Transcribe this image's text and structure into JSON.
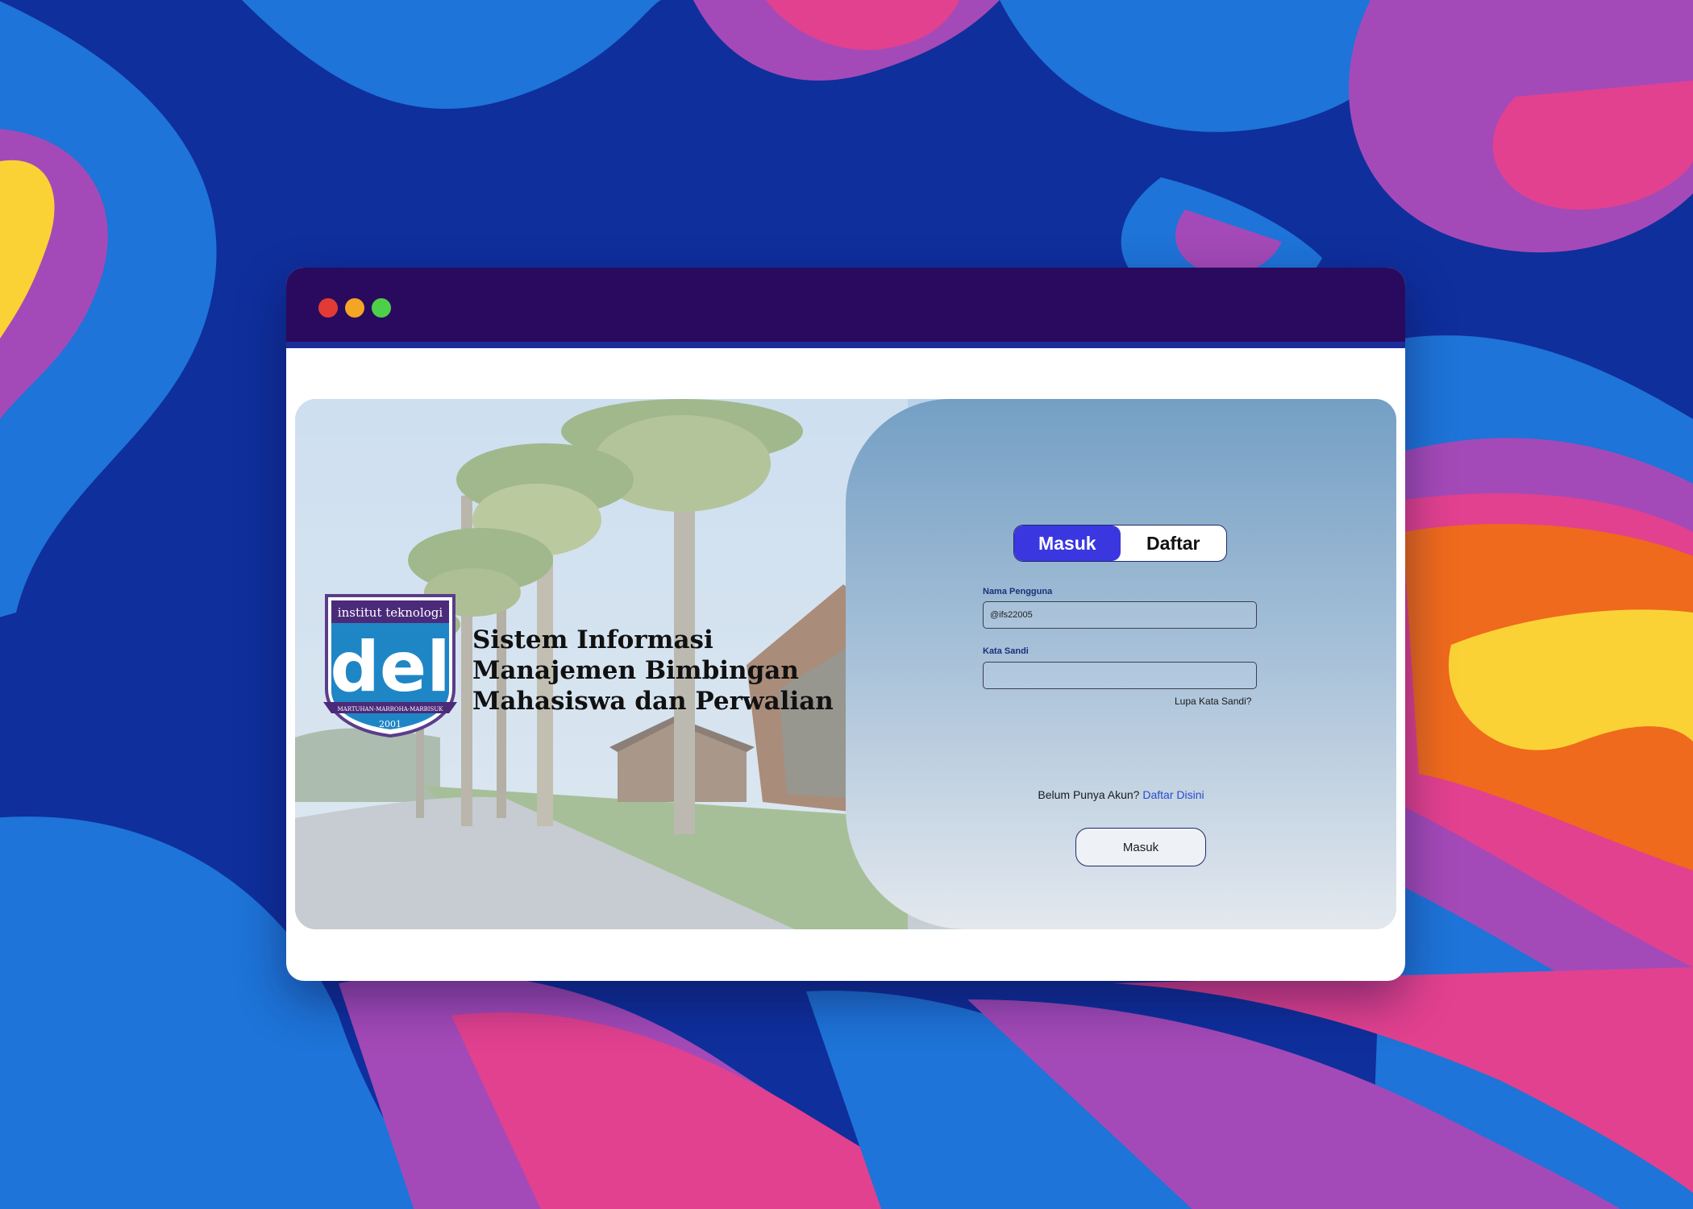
{
  "window": {
    "controls": [
      "close-dot",
      "minimize-dot",
      "maximize-dot"
    ]
  },
  "logo": {
    "top_text": "institut teknologi",
    "wordmark": "del",
    "motto": "MARTUHAN-MARROHA-MARBISUK",
    "year": "2001"
  },
  "app_title": {
    "line1": "Sistem Informasi",
    "line2": "Manajemen Bimbingan",
    "line3": "Mahasiswa dan Perwalian"
  },
  "auth_toggle": {
    "login_label": "Masuk",
    "register_label": "Daftar",
    "active": "login"
  },
  "form": {
    "username_label": "Nama Pengguna",
    "username_value": "@ifs22005",
    "password_label": "Kata Sandi",
    "password_value": "",
    "forgot_label": "Lupa Kata Sandi?",
    "no_account_text": "Belum Punya Akun?",
    "register_link": "Daftar Disini",
    "submit_label": "Masuk"
  },
  "colors": {
    "titlebar": "#2a0a5e",
    "accent": "#3a37e0",
    "link": "#2a4bc9"
  }
}
